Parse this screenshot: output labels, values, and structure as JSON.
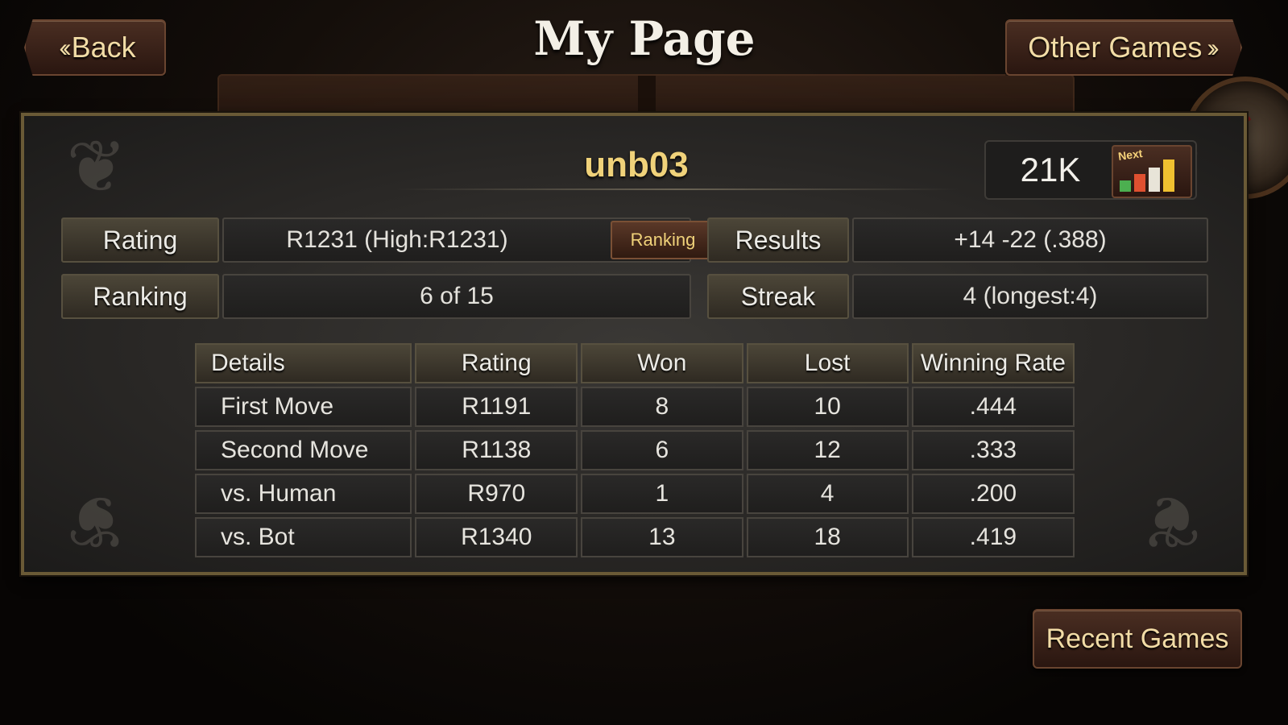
{
  "header": {
    "back_label": "Back",
    "title": "My Page",
    "other_games_label": "Other Games"
  },
  "profile": {
    "username": "unb03",
    "level": "21K",
    "next_label": "Next"
  },
  "stats": {
    "rating_label": "Rating",
    "rating_value": "R1231 (High:R1231)",
    "ranking_button": "Ranking",
    "results_label": "Results",
    "results_value": "+14 -22 (.388)",
    "ranking_label": "Ranking",
    "ranking_value": "6 of 15",
    "streak_label": "Streak",
    "streak_value": "4 (longest:4)"
  },
  "details_table": {
    "headers": [
      "Details",
      "Rating",
      "Won",
      "Lost",
      "Winning Rate"
    ],
    "rows": [
      [
        "First Move",
        "R1191",
        "8",
        "10",
        ".444"
      ],
      [
        "Second Move",
        "R1138",
        "6",
        "12",
        ".333"
      ],
      [
        "vs. Human",
        "R970",
        "1",
        "4",
        ".200"
      ],
      [
        "vs. Bot",
        "R1340",
        "13",
        "18",
        ".419"
      ]
    ]
  },
  "footer": {
    "recent_games_label": "Recent Games"
  },
  "colors": {
    "accent_gold": "#f0d27a",
    "button_brown": "#3a2218",
    "panel_gray": "#2e2c2a"
  }
}
